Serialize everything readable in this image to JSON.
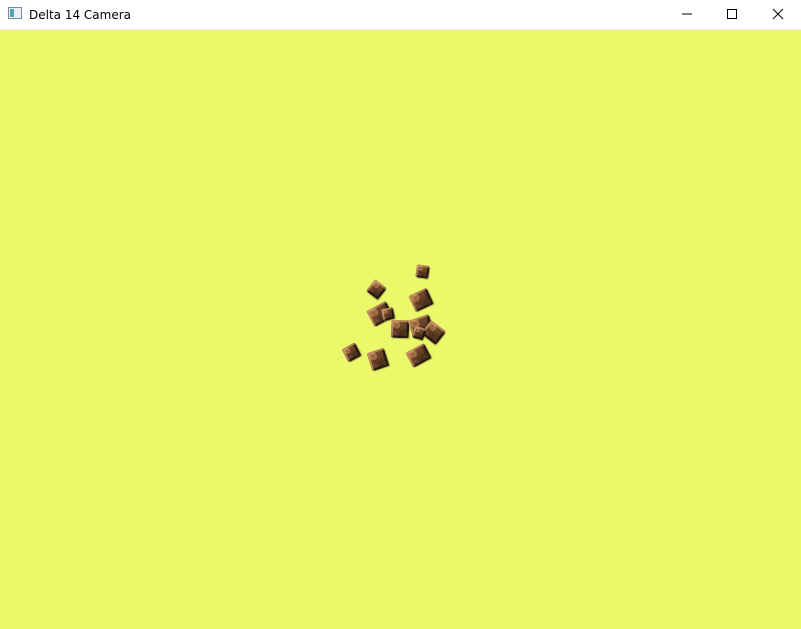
{
  "window": {
    "title": "Delta 14 Camera",
    "controls": {
      "minimize": "minimize-icon",
      "maximize": "maximize-icon",
      "close": "close-icon"
    }
  },
  "scene": {
    "background_color": "#ebf86a",
    "object_type": "wooden cubes",
    "object_count": 12
  }
}
